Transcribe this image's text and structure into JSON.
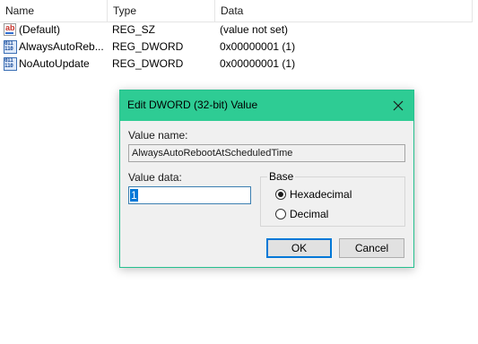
{
  "list": {
    "columns": [
      "Name",
      "Type",
      "Data"
    ],
    "rows": [
      {
        "icon": "string-value-icon",
        "name": "(Default)",
        "type": "REG_SZ",
        "data": "(value not set)"
      },
      {
        "icon": "binary-value-icon",
        "name": "AlwaysAutoReb...",
        "type": "REG_DWORD",
        "data": "0x00000001 (1)"
      },
      {
        "icon": "binary-value-icon",
        "name": "NoAutoUpdate",
        "type": "REG_DWORD",
        "data": "0x00000001 (1)"
      }
    ]
  },
  "dialog": {
    "title": "Edit DWORD (32-bit) Value",
    "value_name_label": "Value name:",
    "value_name": "AlwaysAutoRebootAtScheduledTime",
    "value_data_label": "Value data:",
    "value_data": "1",
    "base_label": "Base",
    "base_options": [
      {
        "label": "Hexadecimal",
        "checked": true
      },
      {
        "label": "Decimal",
        "checked": false
      }
    ],
    "ok_label": "OK",
    "cancel_label": "Cancel"
  },
  "colors": {
    "titlebar": "#2ecc94",
    "accent": "#0078d7"
  }
}
